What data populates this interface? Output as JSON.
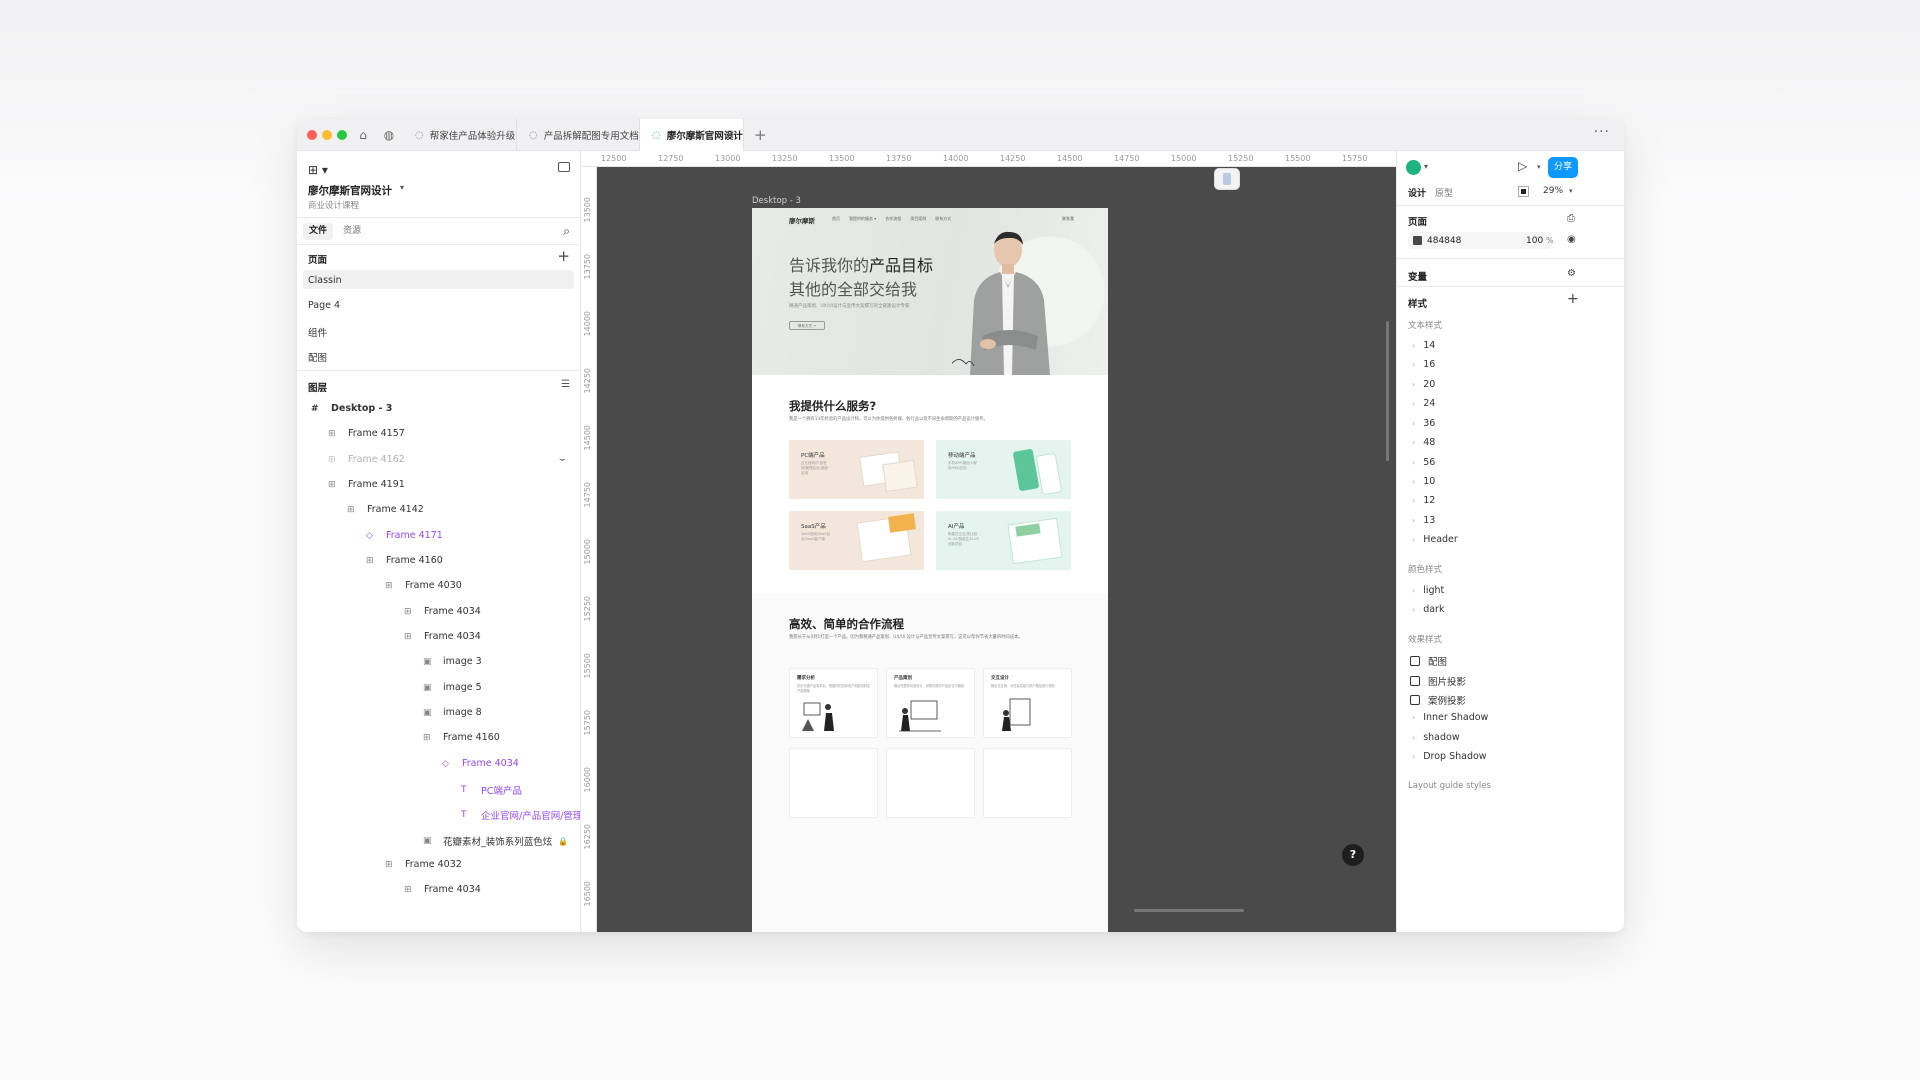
{
  "tabs": [
    {
      "label": "帮家佳产品体验升级"
    },
    {
      "label": "产品拆解配图专用文档"
    },
    {
      "label": "廖尔摩斯官网设计"
    }
  ],
  "left_panel": {
    "file_name": "廖尔摩斯官网设计",
    "team_name": "商业设计课程",
    "tab_file": "文件",
    "tab_assets": "资源",
    "pages_title": "页面",
    "pages": [
      "Classin",
      "Page 4",
      "组件",
      "配图"
    ],
    "layers_title": "图层",
    "layers": [
      {
        "label": "Desktop - 3",
        "icon": "#"
      },
      {
        "label": "Frame 4157",
        "icon": "⊞"
      },
      {
        "label": "Frame 4162",
        "icon": "⊞"
      },
      {
        "label": "Frame 4191",
        "icon": "⊞"
      },
      {
        "label": "Frame 4142",
        "icon": "⊞"
      },
      {
        "label": "Frame 4171",
        "icon": "◇"
      },
      {
        "label": "Frame 4160",
        "icon": "⊞"
      },
      {
        "label": "Frame 4030",
        "icon": "⊞"
      },
      {
        "label": "Frame 4034",
        "icon": "⊞"
      },
      {
        "label": "Frame 4034",
        "icon": "⊞"
      },
      {
        "label": "image 3",
        "icon": "▣"
      },
      {
        "label": "image 5",
        "icon": "▣"
      },
      {
        "label": "image 8",
        "icon": "▣"
      },
      {
        "label": "Frame 4160",
        "icon": "⊞"
      },
      {
        "label": "Frame 4034",
        "icon": "◇"
      },
      {
        "label": "PC端产品",
        "icon": "T"
      },
      {
        "label": "企业官网/产品官网/管理后",
        "icon": "T"
      },
      {
        "label": "花瓣素材_装饰系列蓝色炫",
        "icon": "▣"
      },
      {
        "label": "Frame 4032",
        "icon": "⊞"
      },
      {
        "label": "Frame 4034",
        "icon": "⊞"
      }
    ]
  },
  "ruler": {
    "top": [
      "12500",
      "12750",
      "13000",
      "13250",
      "13500",
      "13750",
      "14000",
      "14250",
      "14500",
      "14750",
      "15000",
      "15250",
      "15500",
      "15750"
    ],
    "left": [
      "13500",
      "13750",
      "14000",
      "14250",
      "14500",
      "14750",
      "15000",
      "15250",
      "15500",
      "15750",
      "16000",
      "16250",
      "16500"
    ]
  },
  "canvas": {
    "frame_label": "Desktop - 3",
    "site": {
      "logo": "廖尔摩斯",
      "nav": [
        "首页",
        "我提供的服务 ▾",
        "合作流程",
        "项目案例",
        "联系方式"
      ],
      "nav_right": "联系我",
      "hero_line1_a": "告诉我你的",
      "hero_line1_b": "产品目标",
      "hero_line2_a": "其他的",
      "hero_line2_b": "全部交给我",
      "hero_sub": "精通产品策划、UX/UI设计与宣传文案撰写的全链路设计专家",
      "hero_btn": "联系方式 →",
      "services_title": "我提供什么服务?",
      "services_sub": "我是一个拥有13年经验的产品设计师。可以为你提供各终端、各行业以及不同生命周期的产品设计服务。",
      "services": [
        {
          "title": "PC端产品",
          "desc": "企业官网/产品官网/管理后台/桌面应用"
        },
        {
          "title": "移动端产品",
          "desc": "手机APP/微信小程序/PAD应用"
        },
        {
          "title": "SaaS产品",
          "desc": "SaaS官网/SaaS后台/SaaS客户端"
        },
        {
          "title": "AI产品",
          "desc": "明星在交互/类比较 AI-UX/智能生AI-UX创新项目"
        }
      ],
      "flow_title": "高效、简单的合作流程",
      "flow_sub": "我擅长于从0到1打造一个产品。因为我精通产品策划、UX/UI 设计与产品宣传文案撰写，这可以帮你节省大量的时间成本。",
      "flow": [
        {
          "title": "需求分析",
          "desc": "初步沟通产品需求后，根据你的目标用户和愿景制定产品策略"
        },
        {
          "title": "产品策划",
          "desc": "输出完整的功能设计，帮助你理清产品定位与路线"
        },
        {
          "title": "交互设计",
          "desc": "输出交互稿，对信息层级与用户路径进行规划"
        }
      ]
    }
  },
  "right_panel": {
    "tab_design": "设计",
    "tab_prototype": "原型",
    "zoom": "29%",
    "share": "分享",
    "page_title": "页面",
    "page_color": "484848",
    "page_opacity": "100",
    "percent": "%",
    "variables_title": "变量",
    "styles_title": "样式",
    "text_styles_title": "文本样式",
    "text_styles": [
      "14",
      "16",
      "20",
      "24",
      "36",
      "48",
      "56",
      "10",
      "12",
      "13",
      "Header"
    ],
    "color_styles_title": "颜色样式",
    "color_styles": [
      "light",
      "dark"
    ],
    "effect_styles_title": "效果样式",
    "effect_checked": [
      "配图",
      "图片投影",
      "案例投影"
    ],
    "effect_styles": [
      "Inner Shadow",
      "shadow",
      "Drop Shadow"
    ],
    "layout_guide": "Layout guide styles",
    "help": "?"
  },
  "colors": {
    "accent": "#0d99ff",
    "purple": "#9747ff",
    "canvas_bg": "#484848"
  }
}
